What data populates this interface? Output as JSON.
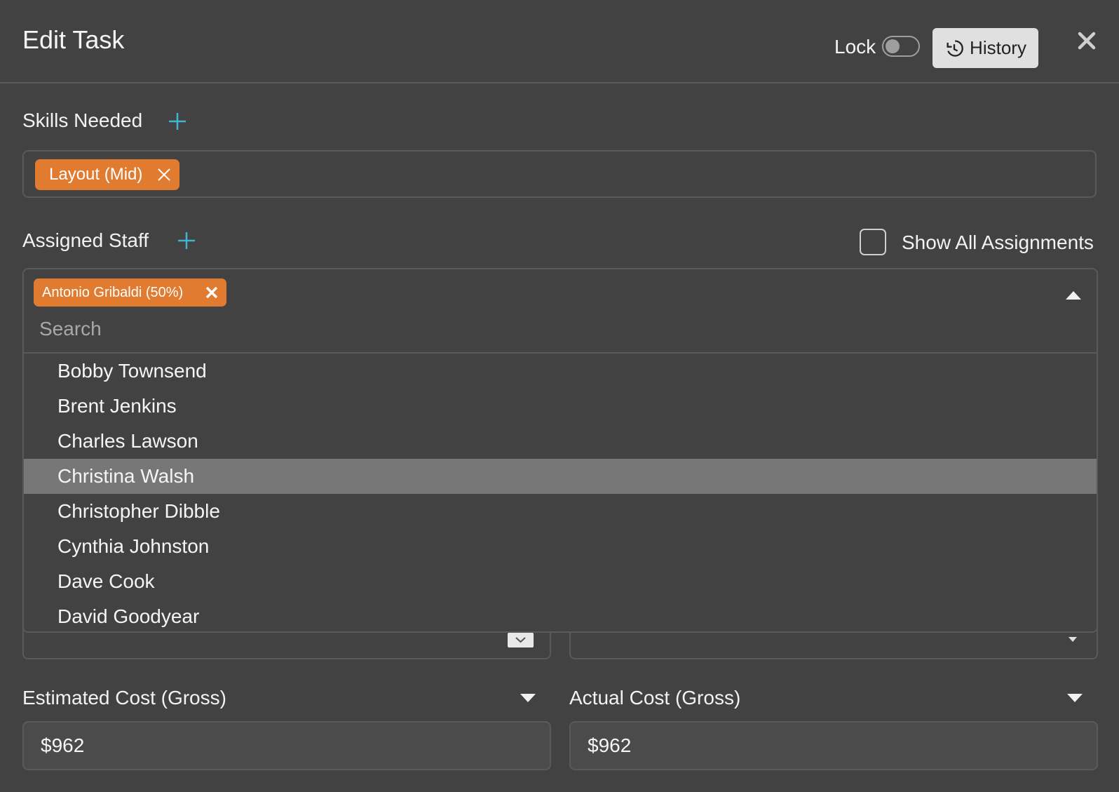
{
  "header": {
    "title": "Edit Task",
    "lock_label": "Lock",
    "lock_on": false,
    "history_label": "History"
  },
  "skills": {
    "label": "Skills Needed",
    "chips": [
      {
        "label": "Layout (Mid)"
      }
    ]
  },
  "staff": {
    "label": "Assigned Staff",
    "show_all_label": "Show All Assignments",
    "show_all_checked": false,
    "selected": [
      {
        "label": "Antonio Gribaldi (50%)"
      }
    ],
    "search_placeholder": "Search",
    "search_value": "",
    "options": [
      "Bobby Townsend",
      "Brent Jenkins",
      "Charles Lawson",
      "Christina Walsh",
      "Christopher Dibble",
      "Cynthia Johnston",
      "Dave Cook",
      "David Goodyear"
    ],
    "highlighted_option": "Christina Walsh"
  },
  "costs": {
    "estimated_label": "Estimated Cost (Gross)",
    "estimated_value": "$962",
    "actual_label": "Actual Cost (Gross)",
    "actual_value": "$962"
  },
  "colors": {
    "background": "#424242",
    "chip": "#e07b30",
    "accent_plus": "#3fb5d6",
    "highlight_row": "#777777"
  }
}
